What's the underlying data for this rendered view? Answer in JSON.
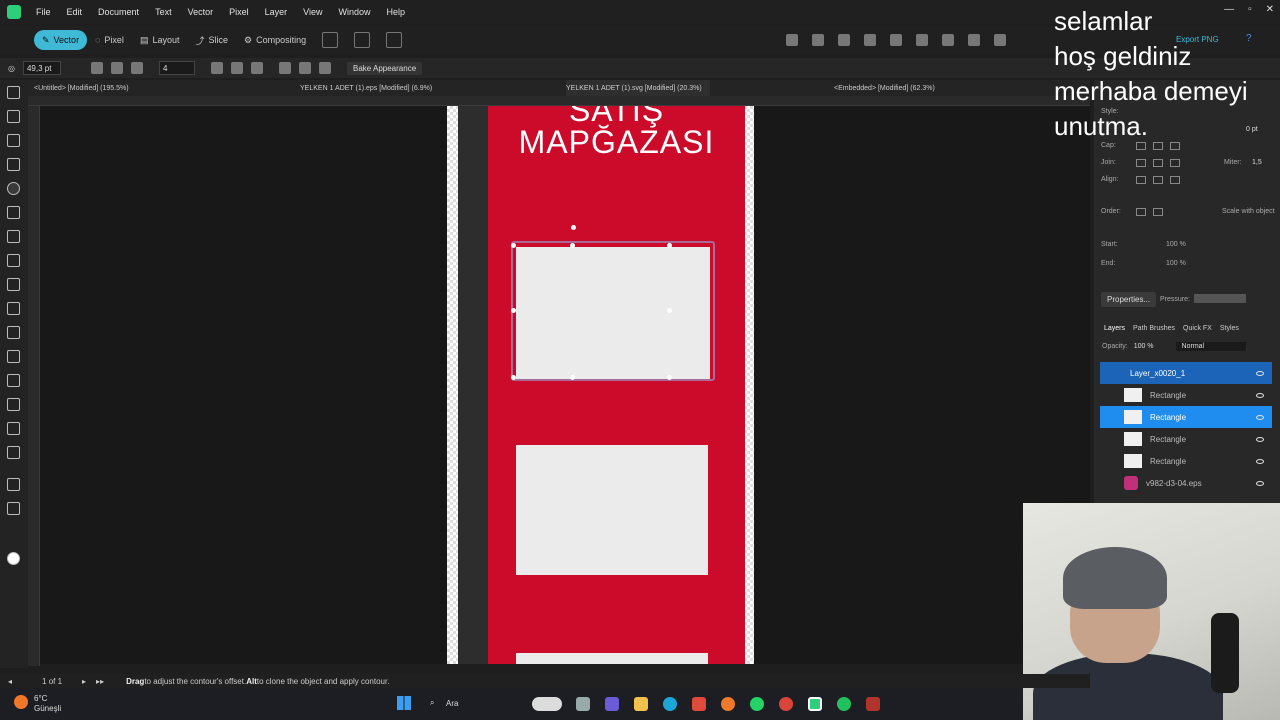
{
  "menu": [
    "File",
    "Edit",
    "Document",
    "Text",
    "Vector",
    "Pixel",
    "Layer",
    "View",
    "Window",
    "Help"
  ],
  "window_controls": [
    "—",
    "▫",
    "✕"
  ],
  "personas": [
    "Vector",
    "Pixel",
    "Layout",
    "Slice",
    "Compositing"
  ],
  "export_label": "Export PNG",
  "context": {
    "stroke_width": "49,3 pt",
    "count": "4",
    "bake": "Bake Appearance"
  },
  "tabs": [
    "<Untitled> [Modified] (195.5%)",
    "YELKEN 1 ADET (1).eps [Modified] (6.9%)",
    "YELKEN 1 ADET (1).svg [Modified] (20.3%)",
    "<Embedded> [Modified] (62.3%)"
  ],
  "poster": {
    "line1": "SATIŞ",
    "line2": "MAPĞAZASI",
    "color": "#cc0b2b"
  },
  "stroke_panel": {
    "style": "Style:",
    "cap": "Cap:",
    "join": "Join:",
    "miter_label": "Miter:",
    "miter_value": "1,5",
    "align": "Align:",
    "width_value": "0 pt",
    "order": "Order:",
    "scale_with_object": "Scale with object",
    "start": "Start:",
    "end": "End:",
    "start_pct": "100 %",
    "end_pct": "100 %",
    "properties": "Properties...",
    "pressure": "Pressure:"
  },
  "layers": {
    "tabs": [
      "Layers",
      "Path Brushes",
      "Quick FX",
      "Styles"
    ],
    "opacity_label": "Opacity:",
    "opacity_value": "100 %",
    "blend": "Normal",
    "items": [
      "Layer_x0020_1",
      "Rectangle",
      "Rectangle",
      "Rectangle",
      "Rectangle",
      "v982-d3-04.eps"
    ]
  },
  "overlay_text": [
    "selamlar",
    "hoş geldiniz",
    "merhaba demeyi",
    "unutma."
  ],
  "status": {
    "page": "1 of 1",
    "hint_bold1": "Drag",
    "hint1": " to adjust the contour's offset. ",
    "hint_bold2": "Alt",
    "hint2": " to clone the object and apply contour."
  },
  "taskbar": {
    "temp": "6°C",
    "weather": "Güneşli",
    "search": "Ara"
  }
}
